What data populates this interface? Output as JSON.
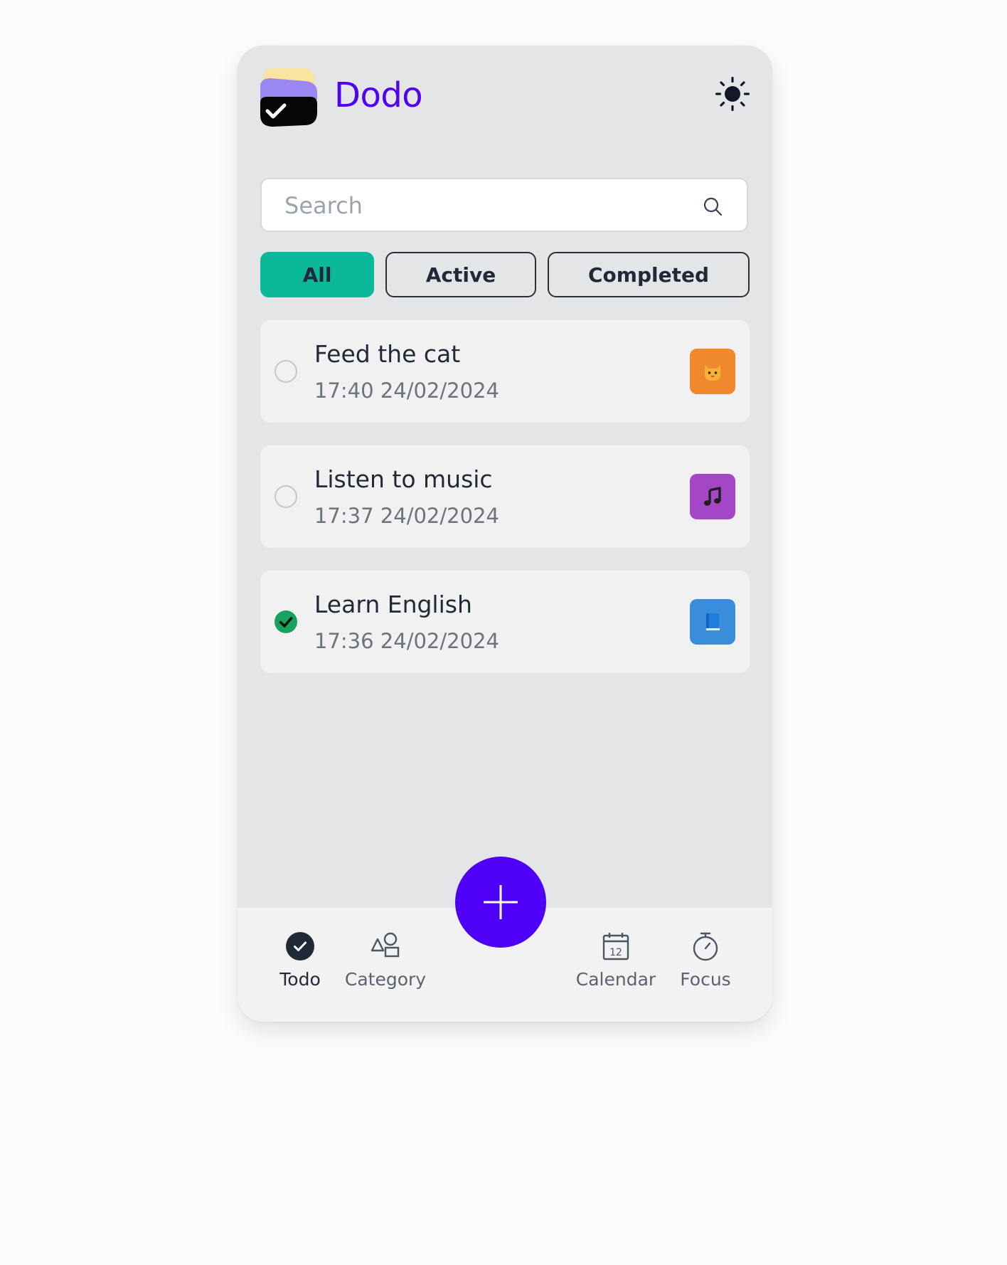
{
  "app": {
    "title": "Dodo",
    "accent_color": "#4f00f6",
    "theme_icon": "sun-icon"
  },
  "search": {
    "placeholder": "Search",
    "value": "",
    "icon": "search-icon"
  },
  "filters": [
    {
      "label": "All",
      "selected": true
    },
    {
      "label": "Active",
      "selected": false
    },
    {
      "label": "Completed",
      "selected": false
    }
  ],
  "filter_selected_color": "#0bb89a",
  "tasks": [
    {
      "title": "Feed the cat",
      "time": "17:40 24/02/2024",
      "completed": false,
      "category_icon": "cat-face-icon",
      "category_color": "#f0892e"
    },
    {
      "title": "Listen to music",
      "time": "17:37 24/02/2024",
      "completed": false,
      "category_icon": "music-note-icon",
      "category_color": "#a347c6"
    },
    {
      "title": "Learn English",
      "time": "17:36 24/02/2024",
      "completed": true,
      "category_icon": "book-icon",
      "category_color": "#3a8ddb"
    }
  ],
  "completed_check_color": "#17a35d",
  "fab": {
    "icon": "plus-icon"
  },
  "nav": {
    "todo": {
      "label": "Todo",
      "icon": "check-circle-icon"
    },
    "category": {
      "label": "Category",
      "icon": "shapes-icon"
    },
    "calendar": {
      "label": "Calendar",
      "icon": "calendar-icon",
      "day": "12"
    },
    "focus": {
      "label": "Focus",
      "icon": "stopwatch-icon"
    }
  }
}
